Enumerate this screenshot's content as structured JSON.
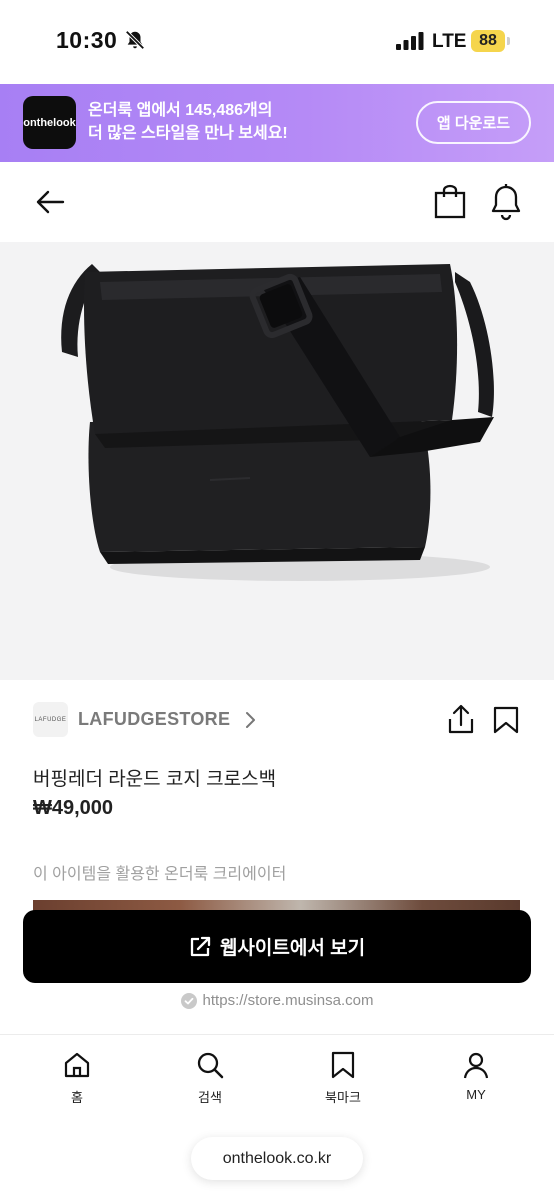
{
  "status_bar": {
    "time": "10:30",
    "network": "LTE",
    "battery": "88"
  },
  "promo": {
    "logo_text": "onthelook",
    "line1": "온더룩 앱에서 145,486개의",
    "line2": "더 많은 스타일을 만나 보세요!",
    "button": "앱 다운로드"
  },
  "product": {
    "store_logo_text": "LAFUDGE",
    "store_name": "LAFUDGESTORE",
    "title": "버핑레더 라운드 코지 크로스백",
    "price": "₩49,000",
    "creators_label": "이 아이템을 활용한 온더룩 크리에이터"
  },
  "cta": {
    "label": "웹사이트에서 보기"
  },
  "source_url": "https://store.musinsa.com",
  "nav": {
    "home": "홈",
    "search": "검색",
    "bookmark": "북마크",
    "my": "MY"
  },
  "browser_url": "onthelook.co.kr",
  "colors": {
    "promo": "#b086f6",
    "cta": "#000000",
    "battery": "#f5d54c"
  }
}
